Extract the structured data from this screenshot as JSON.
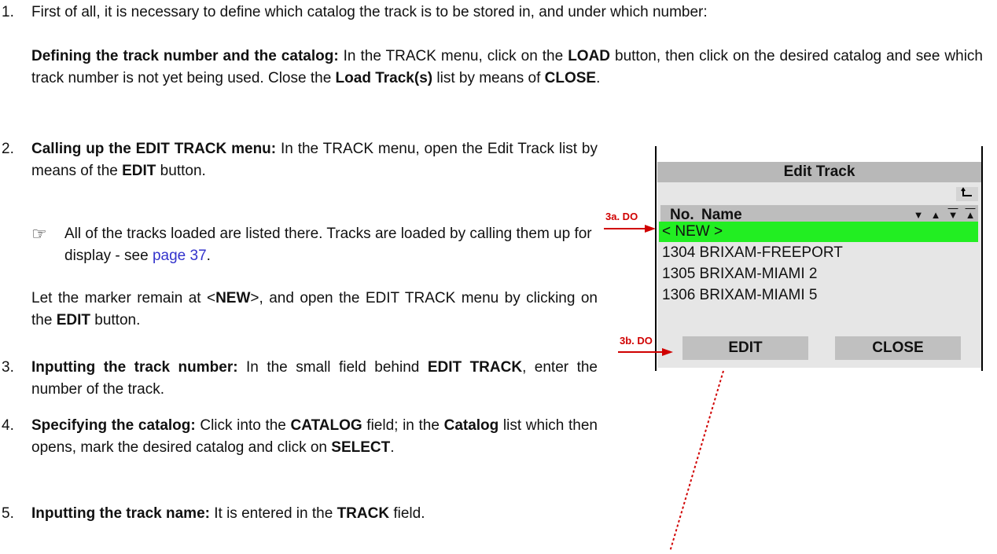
{
  "steps": [
    {
      "num": "1.",
      "text": "First of all, it is necessary to define which catalog the track is to be stored in, and under which number:"
    },
    {
      "num": "2."
    },
    {
      "num": "3."
    },
    {
      "num": "4."
    },
    {
      "num": "5."
    }
  ],
  "step1_sub": {
    "b1": "Defining the track number and the catalog:",
    "t1": " In the TRACK menu, click on the ",
    "b2": "LOAD",
    "t2": " button, then click on the desired catalog and see which track number is not yet being used. Close the ",
    "b3": "Load Track(s)",
    "t3": " list by means of ",
    "b4": "CLOSE",
    "t4": "."
  },
  "step2": {
    "b1": "Calling up the EDIT TRACK menu:",
    "t1": " In the TRACK menu, open the Edit Track list by means of the ",
    "b2": "EDIT",
    "t2": " button."
  },
  "note": {
    "icon": "pointing-hand-icon",
    "text": "All of the tracks loaded are listed there. Tracks are loaded by calling them up for display - see ",
    "link": "page 37",
    "end": "."
  },
  "marker_para": {
    "t1": "Let the marker remain at <",
    "b1": "NEW",
    "t2": ">, and open the EDIT TRACK menu by clicking on the ",
    "b2": "EDIT",
    "t3": " button."
  },
  "step3": {
    "b1": "Inputting the track number:",
    "t1": " In the small field behind ",
    "b2": "EDIT TRACK",
    "t2": ", enter the number of the track."
  },
  "step4": {
    "b1": "Specifying the catalog:",
    "t1": " Click into the ",
    "b2": "CATALOG",
    "t2": " field; in the ",
    "b3": "Catalog",
    "t3": " list which then opens, mark the desired catalog and click on ",
    "b4": "SELECT",
    "t4": "."
  },
  "step5": {
    "b1": "Inputting the track name:",
    "t1": " It is entered in the ",
    "b2": "TRACK",
    "t2": " field."
  },
  "screen": {
    "title": "Edit Track",
    "back_icon": "return-arrow-icon",
    "col_no": "No.",
    "col_name": "Name",
    "rows": [
      "< NEW >",
      "1304 BRIXAM-FREEPORT",
      "1305 BRIXAM-MIAMI 2",
      "1306 BRIXAM-MIAMI 5"
    ],
    "edit_label": "EDIT",
    "close_label": "CLOSE"
  },
  "callouts": {
    "a": "3a. DO",
    "b": "3b. DO"
  },
  "colors": {
    "selection": "#22ee22",
    "callout": "#d00000",
    "link": "#3333cc"
  }
}
